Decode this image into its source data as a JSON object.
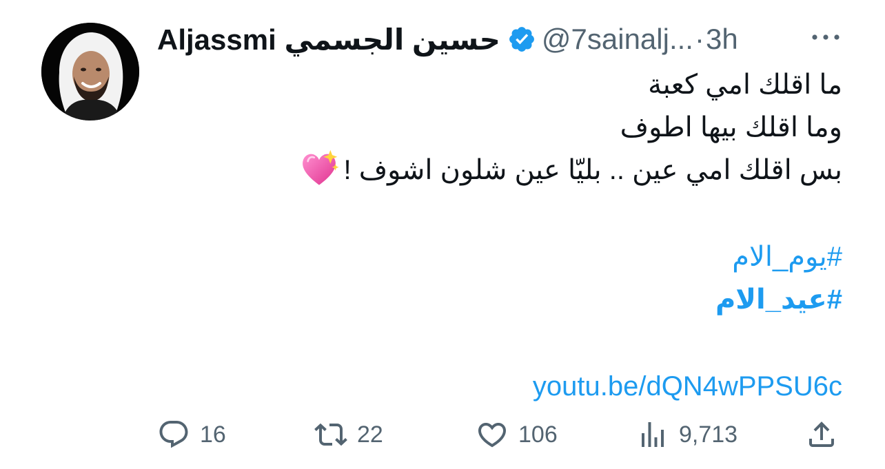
{
  "tweet": {
    "author_name": "Aljassmi حسين الجسمي",
    "verified": true,
    "handle": "@7sainalj...",
    "separator": "·",
    "time": "3h",
    "text_lines": [
      "ما اقلك امي كعبة",
      "وما اقلك بيها اطوف",
      "بس اقلك امي عين .. بليّا عين شلون اشوف !"
    ],
    "text_emoji": "sparkling-heart-emoji",
    "hashtags": [
      "#يوم_الام",
      "#عيد_الام"
    ],
    "link": "youtu.be/dQN4wPPSU6c"
  },
  "actions": {
    "replies": "16",
    "retweets": "22",
    "likes": "106",
    "views": "9,713"
  },
  "colors": {
    "accent": "#1d9bf0",
    "text": "#0f1419",
    "secondary": "#536471"
  },
  "icons": [
    "more-icon",
    "verified-badge-icon",
    "reply-icon",
    "retweet-icon",
    "like-icon",
    "views-icon",
    "share-icon"
  ]
}
